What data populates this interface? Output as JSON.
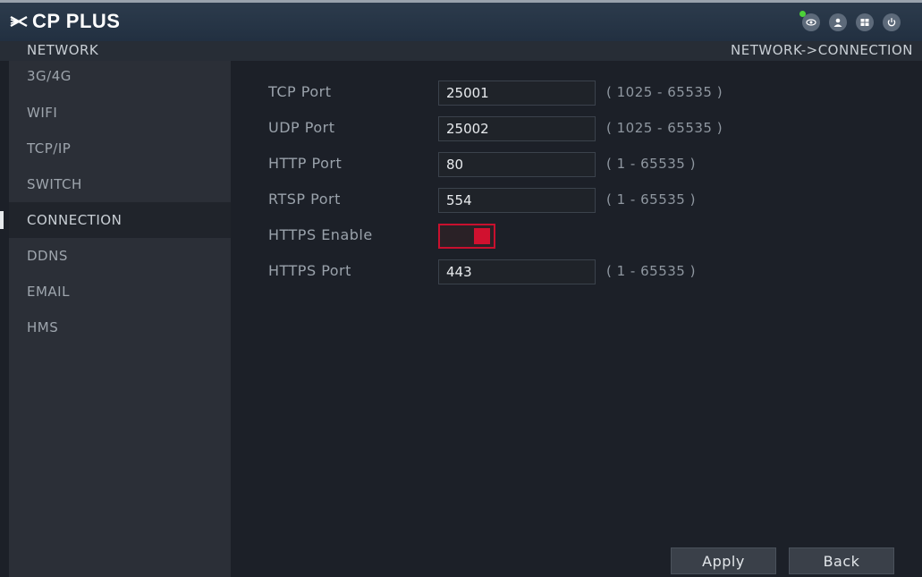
{
  "brand": {
    "name": "CP PLUS"
  },
  "header": {
    "section_title": "NETWORK",
    "breadcrumb": "NETWORK->CONNECTION"
  },
  "top_icons": [
    "eye-icon",
    "user-icon",
    "grid-icon",
    "power-icon"
  ],
  "sidebar": {
    "items": [
      {
        "label": "3G/4G",
        "active": false
      },
      {
        "label": "WIFI",
        "active": false
      },
      {
        "label": "TCP/IP",
        "active": false
      },
      {
        "label": "SWITCH",
        "active": false
      },
      {
        "label": "CONNECTION",
        "active": true
      },
      {
        "label": "DDNS",
        "active": false
      },
      {
        "label": "EMAIL",
        "active": false
      },
      {
        "label": "HMS",
        "active": false
      }
    ]
  },
  "form": {
    "tcp_port": {
      "label": "TCP Port",
      "value": "25001",
      "range": "( 1025 - 65535 )"
    },
    "udp_port": {
      "label": "UDP Port",
      "value": "25002",
      "range": "( 1025 - 65535 )"
    },
    "http_port": {
      "label": "HTTP Port",
      "value": "80",
      "range": "( 1 - 65535 )"
    },
    "rtsp_port": {
      "label": "RTSP Port",
      "value": "554",
      "range": "( 1 - 65535 )"
    },
    "https_enable": {
      "label": "HTTPS Enable",
      "enabled": true
    },
    "https_port": {
      "label": "HTTPS Port",
      "value": "443",
      "range": "( 1 - 65535 )"
    }
  },
  "buttons": {
    "apply_label": "Apply",
    "back_label": "Back"
  },
  "colors": {
    "accent_red": "#d1112f",
    "status_green": "#4cd137"
  }
}
